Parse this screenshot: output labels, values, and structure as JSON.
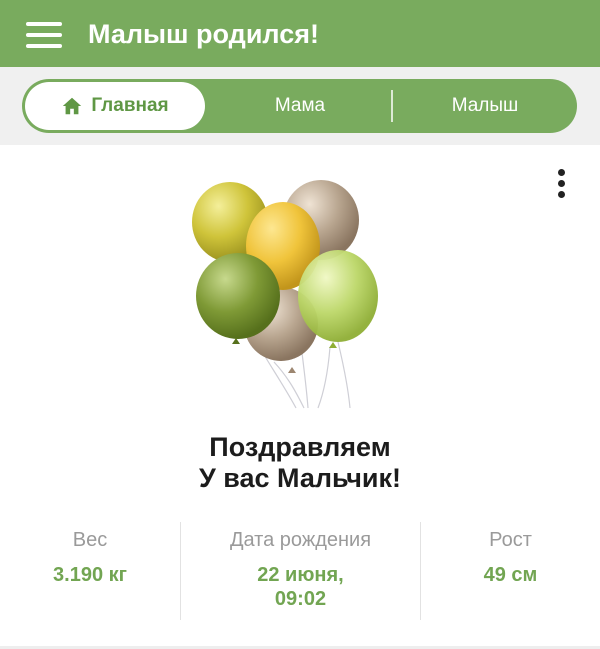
{
  "header": {
    "title": "Малыш родился!",
    "menu_icon": "hamburger-menu-icon",
    "background": "#79ab5e"
  },
  "tabs": [
    {
      "label": "Главная",
      "icon": "home-icon",
      "active": true
    },
    {
      "label": "Мама",
      "active": false
    },
    {
      "label": "Малыш",
      "active": false
    }
  ],
  "card": {
    "menu_icon": "more-vertical-icon",
    "image": "balloons-illustration",
    "headline_line1": "Поздравляем",
    "headline_line2": "У вас Мальчик!"
  },
  "stats": {
    "weight": {
      "label": "Вес",
      "value": "3.190 кг"
    },
    "birth_date": {
      "label": "Дата рождения",
      "value_line1": "22 июня,",
      "value_line2": "09:02"
    },
    "height": {
      "label": "Рост",
      "value": "49 см"
    }
  },
  "colors": {
    "accent": "#79ab5e",
    "value_text": "#72a552",
    "label_text": "#9a9a9a"
  }
}
